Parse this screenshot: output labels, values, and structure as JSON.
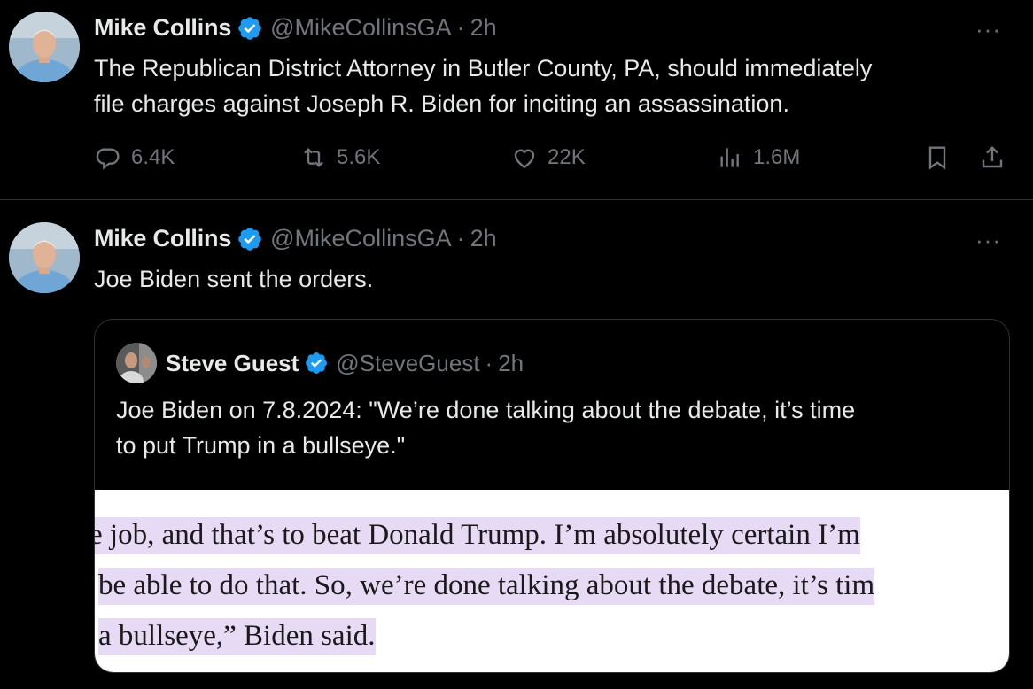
{
  "tweets": [
    {
      "author": "Mike Collins",
      "handle": "@MikeCollinsGA",
      "dot": "·",
      "time": "2h",
      "more": "···",
      "text_lines": [
        "The Republican District Attorney in Butler County, PA, should immediately",
        "file charges against Joseph R. Biden for inciting an assassination."
      ],
      "stats": {
        "replies": "6.4K",
        "reposts": "5.6K",
        "likes": "22K",
        "views": "1.6M"
      }
    },
    {
      "author": "Mike Collins",
      "handle": "@MikeCollinsGA",
      "dot": "·",
      "time": "2h",
      "more": "···",
      "text": "Joe Biden sent the orders.",
      "quote": {
        "author": "Steve Guest",
        "handle": "@SteveGuest",
        "dot": "·",
        "time": "2h",
        "text_lines": [
          "Joe Biden on 7.8.2024: \"We’re done talking about the debate, it’s time",
          "to put Trump in a bullseye.\""
        ],
        "image_lines": [
          "e job, and that’s to beat Donald Trump. I’m absolutely certain I’m",
          "be able to do that. So, we’re done talking about the debate, it’s tim",
          "a bullseye,” Biden said."
        ]
      }
    }
  ],
  "colors": {
    "background": "#000000",
    "text": "#e7e9ea",
    "muted": "#71767b",
    "verified": "#1d9bf0",
    "divider": "#2f3336",
    "highlight": "#e6daf5"
  },
  "icons": [
    "reply-icon",
    "repost-icon",
    "like-icon",
    "views-icon",
    "bookmark-icon",
    "share-icon",
    "verified-badge-icon",
    "more-icon"
  ]
}
